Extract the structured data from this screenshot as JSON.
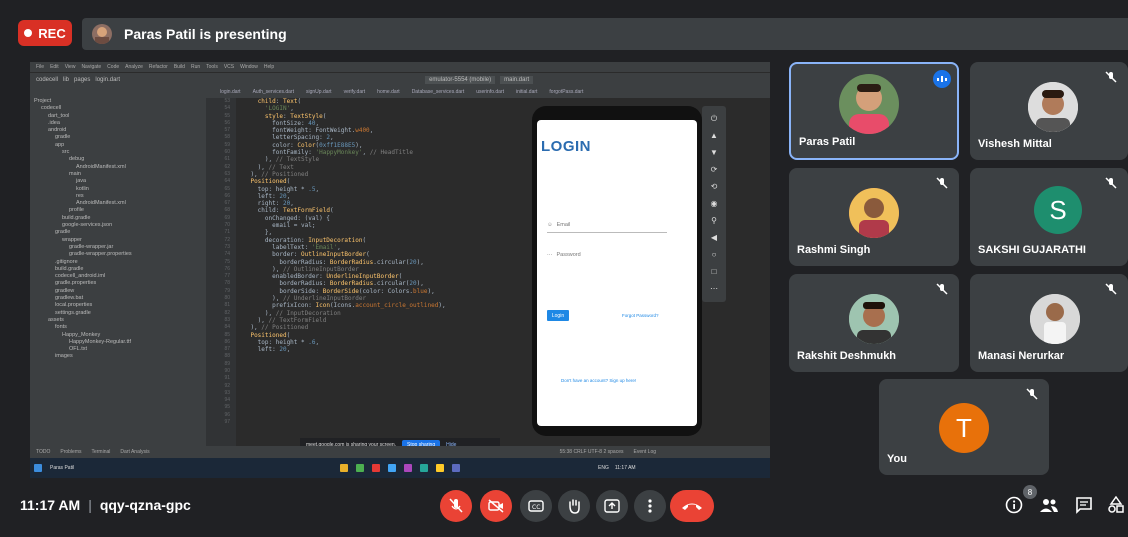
{
  "top": {
    "rec_label": "REC",
    "presenter_text": "Paras Patil is presenting"
  },
  "shared_screen": {
    "ide_menu": [
      "File",
      "Edit",
      "View",
      "Navigate",
      "Code",
      "Analyze",
      "Refactor",
      "Build",
      "Run",
      "Tools",
      "VCS",
      "Window",
      "Help"
    ],
    "toolbar": {
      "project": "codecell",
      "path1": "lib",
      "path2": "pages",
      "file": "login.dart",
      "device": "emulator-5554 (mobile)",
      "run_config": "main.dart"
    },
    "tabs": [
      "login.dart",
      "Auth_services.dart",
      "signUp.dart",
      "verify.dart",
      "home.dart",
      "Database_services.dart",
      "userinfo.dart",
      "initial.dart",
      "forgotPass.dart"
    ],
    "project_tree": [
      "Project",
      "codecell",
      "dart_tool",
      ".idea",
      "android",
      "gradle",
      "app",
      "src",
      "debug",
      "AndroidManifest.xml",
      "main",
      "java",
      "kotlin",
      "res",
      "AndroidManifest.xml",
      "profile",
      "build.gradle",
      "google-services.json",
      "gradle",
      "wrapper",
      "gradle-wrapper.jar",
      "gradle-wrapper.properties",
      ".gitignore",
      "build.gradle",
      "codecell_android.iml",
      "gradle.properties",
      "gradlew",
      "gradlew.bat",
      "local.properties",
      "settings.gradle",
      "assets",
      "fonts",
      "Happy_Monkey",
      "HappyMonkey-Regular.ttf",
      "OFL.txt",
      "images"
    ],
    "line_numbers": [
      "53",
      "54",
      "55",
      "56",
      "57",
      "58",
      "59",
      "60",
      "61",
      "62",
      "63",
      "64",
      "65",
      "66",
      "67",
      "68",
      "69",
      "70",
      "71",
      "72",
      "73",
      "74",
      "75",
      "76",
      "77",
      "78",
      "79",
      "80",
      "81",
      "82",
      "83",
      "84",
      "85",
      "86",
      "87",
      "88",
      "89",
      "90",
      "91",
      "92",
      "93",
      "94",
      "95",
      "96",
      "97"
    ],
    "app": {
      "title": "LOGIN",
      "email_hint": "Email",
      "password_hint": "Password",
      "login_button": "Login",
      "forgot": "Forgot Password?",
      "signup": "Don't have an account? Sign up here!"
    },
    "share_notice": "meet.google.com is sharing your screen.",
    "stop_sharing": "Stop sharing",
    "hide": "Hide",
    "status_left": [
      "TODO",
      "Problems",
      "Terminal",
      "Dart Analysis"
    ],
    "status_right": "55:38  CRLF  UTF-8  2 spaces",
    "event_log": "Event Log",
    "taskbar_user": "Paras Patil",
    "taskbar_lang": "ENG",
    "taskbar_time": "11:17 AM"
  },
  "participants": [
    {
      "name": "Paras Patil",
      "muted": false,
      "speaking": true
    },
    {
      "name": "Vishesh Mittal",
      "muted": true
    },
    {
      "name": "Rashmi Singh",
      "muted": true
    },
    {
      "name": "SAKSHI GUJARATHI",
      "muted": true,
      "initial": "S",
      "color": "#1e8e6e"
    },
    {
      "name": "Rakshit Deshmukh",
      "muted": true
    },
    {
      "name": "Manasi Nerurkar",
      "muted": true
    },
    {
      "name": "You",
      "muted": true,
      "initial": "T",
      "color": "#e8710a"
    }
  ],
  "bottom": {
    "time": "11:17 AM",
    "meeting_code": "qqy-qzna-gpc",
    "people_count": "8"
  },
  "colors": {
    "rec": "#d93025",
    "red_control": "#ea4335",
    "tile": "#3c4043",
    "speaking_border": "#8ab4f8"
  }
}
